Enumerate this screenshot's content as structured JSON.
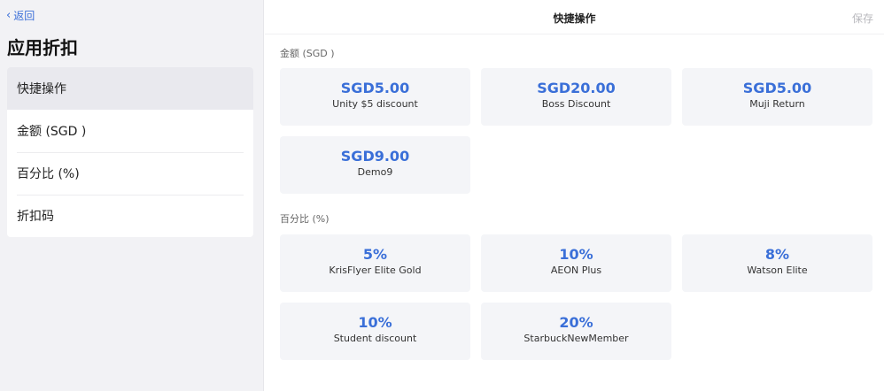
{
  "sidebar": {
    "back_label": "返回",
    "title": "应用折扣",
    "items": [
      {
        "label": "快捷操作",
        "active": true
      },
      {
        "label": "金额 (SGD )",
        "active": false
      },
      {
        "label": "百分比 (%)",
        "active": false
      },
      {
        "label": "折扣码",
        "active": false
      }
    ]
  },
  "header": {
    "title": "快捷操作",
    "save_label": "保存"
  },
  "amount_section": {
    "label": "金额 (SGD )",
    "cards": [
      {
        "value": "SGD5.00",
        "name": "Unity $5 discount"
      },
      {
        "value": "SGD20.00",
        "name": "Boss Discount"
      },
      {
        "value": "SGD5.00",
        "name": "Muji Return"
      },
      {
        "value": "SGD9.00",
        "name": "Demo9"
      }
    ]
  },
  "percent_section": {
    "label": "百分比 (%)",
    "cards": [
      {
        "value": "5%",
        "name": "KrisFlyer Elite Gold"
      },
      {
        "value": "10%",
        "name": "AEON Plus"
      },
      {
        "value": "8%",
        "name": "Watson Elite"
      },
      {
        "value": "10%",
        "name": "Student discount"
      },
      {
        "value": "20%",
        "name": "StarbuckNewMember"
      }
    ]
  },
  "colors": {
    "accent": "#3a6fd8",
    "card_bg": "#f4f5f8",
    "sidebar_bg": "#f2f2f5"
  }
}
